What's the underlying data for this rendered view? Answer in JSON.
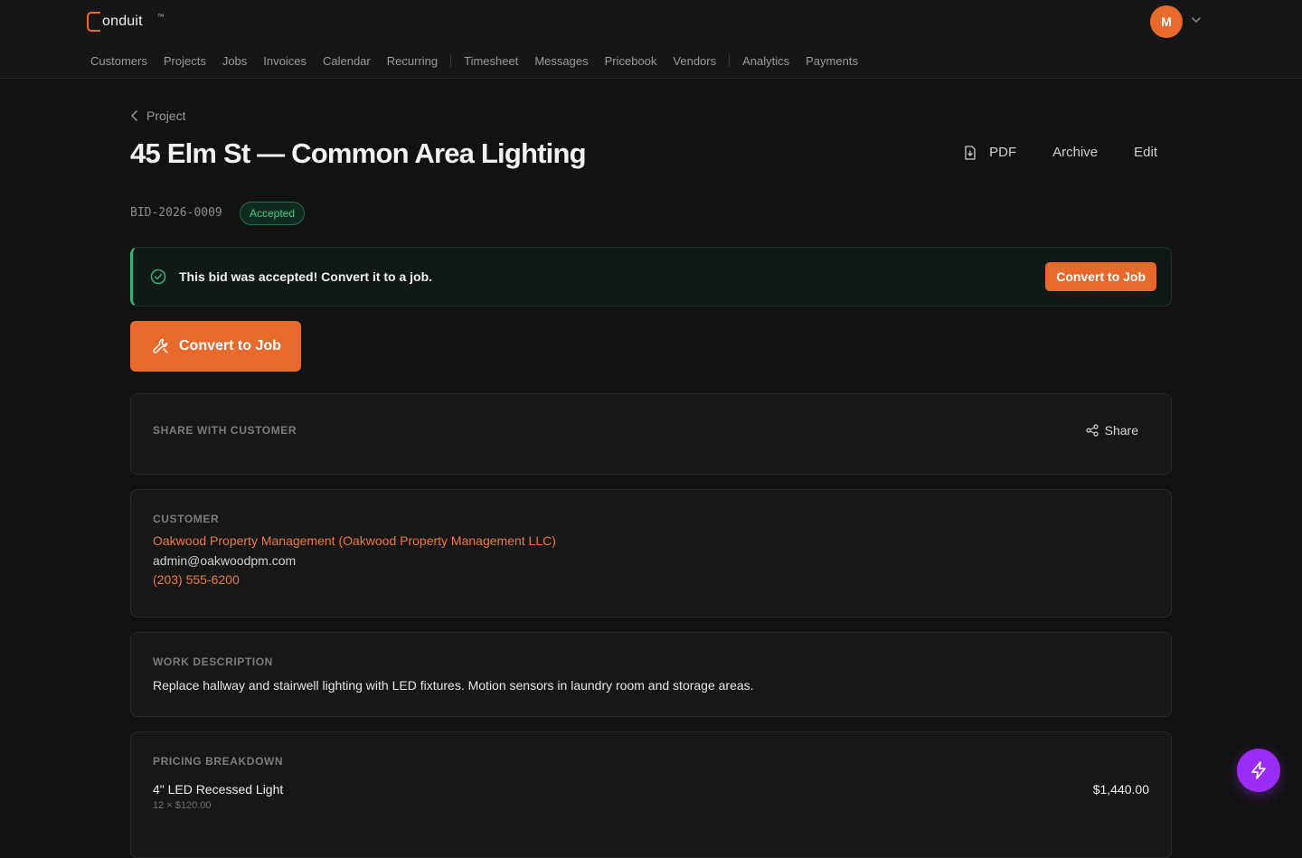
{
  "app": {
    "logo_text": "onduit",
    "logo_tm": "™",
    "avatar_initial": "M"
  },
  "nav": {
    "items": [
      "Customers",
      "Projects",
      "Jobs",
      "Invoices",
      "Calendar",
      "Recurring",
      "Timesheet",
      "Messages",
      "Pricebook",
      "Vendors",
      "Analytics",
      "Payments"
    ]
  },
  "page": {
    "back_label": "Project",
    "title": "45 Elm St — Common Area Lighting",
    "bid_id": "BID-2026-0009",
    "status": "Accepted",
    "actions": {
      "pdf": "PDF",
      "archive": "Archive",
      "edit": "Edit"
    }
  },
  "alert": {
    "text": "This bid was accepted! Convert it to a job.",
    "button": "Convert to Job"
  },
  "convert_button": "Convert to Job",
  "share": {
    "label": "SHARE WITH CUSTOMER",
    "button": "Share"
  },
  "customer": {
    "label": "CUSTOMER",
    "name": "Oakwood Property Management (Oakwood Property Management LLC)",
    "email": "admin@oakwoodpm.com",
    "phone": "(203) 555-6200"
  },
  "work": {
    "label": "WORK DESCRIPTION",
    "text": "Replace hallway and stairwell lighting with LED fixtures. Motion sensors in laundry room and storage areas."
  },
  "pricing": {
    "label": "PRICING BREAKDOWN",
    "items": [
      {
        "name": "4\" LED Recessed Light",
        "detail": "12 × $120.00",
        "amount": "$1,440.00"
      }
    ]
  },
  "colors": {
    "accent": "#e8692c",
    "success": "#3fd08a",
    "fab": "#9b2cf5"
  }
}
